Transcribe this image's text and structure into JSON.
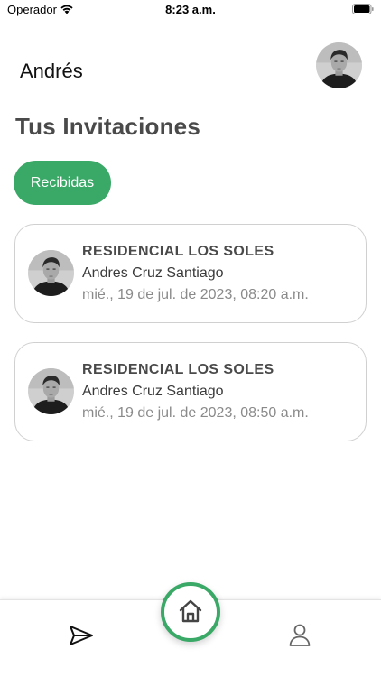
{
  "status_bar": {
    "carrier": "Operador",
    "time": "8:23 a.m."
  },
  "header": {
    "username": "Andrés",
    "avatar_icon": "user-photo-avatar"
  },
  "page": {
    "title": "Tus Invitaciones",
    "filter_chip": "Recibidas"
  },
  "invitations": [
    {
      "title": "RESIDENCIAL LOS SOLES",
      "name": "Andres Cruz Santiago",
      "date": "mié., 19 de jul. de 2023, 08:20 a.m."
    },
    {
      "title": "RESIDENCIAL LOS SOLES",
      "name": "Andres Cruz Santiago",
      "date": "mié., 19 de jul. de 2023, 08:50 a.m."
    }
  ],
  "bottom_nav": {
    "left_icon": "send-icon",
    "center_icon": "home-icon",
    "right_icon": "profile-icon"
  },
  "colors": {
    "accent": "#3aa866",
    "title_gray": "#4a4a4a",
    "date_gray": "#8a8a8a",
    "card_border": "#d0d0d0"
  }
}
